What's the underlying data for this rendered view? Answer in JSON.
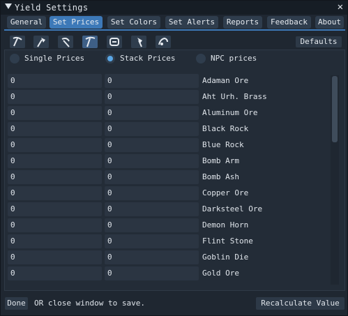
{
  "window": {
    "title": "Yield Settings"
  },
  "tabs": [
    {
      "label": "General"
    },
    {
      "label": "Set Prices"
    },
    {
      "label": "Set Colors"
    },
    {
      "label": "Set Alerts"
    },
    {
      "label": "Reports"
    },
    {
      "label": "Feedback"
    },
    {
      "label": "About"
    }
  ],
  "tools": [
    "pickaxe-icon",
    "hatchet-icon",
    "sickle-icon",
    "pickaxe-alt-icon",
    "fishing-rod-icon",
    "hatchet-alt-icon",
    "clamming-icon"
  ],
  "defaults_label": "Defaults",
  "price_modes": [
    {
      "label": "Single Prices",
      "selected": false
    },
    {
      "label": "Stack Prices",
      "selected": true
    },
    {
      "label": "NPC prices",
      "selected": false
    }
  ],
  "items": [
    {
      "price1": "0",
      "price2": "0",
      "name": "Adaman Ore"
    },
    {
      "price1": "0",
      "price2": "0",
      "name": "Aht Urh. Brass"
    },
    {
      "price1": "0",
      "price2": "0",
      "name": "Aluminum Ore"
    },
    {
      "price1": "0",
      "price2": "0",
      "name": "Black Rock"
    },
    {
      "price1": "0",
      "price2": "0",
      "name": "Blue Rock"
    },
    {
      "price1": "0",
      "price2": "0",
      "name": "Bomb Arm"
    },
    {
      "price1": "0",
      "price2": "0",
      "name": "Bomb Ash"
    },
    {
      "price1": "0",
      "price2": "0",
      "name": "Copper Ore"
    },
    {
      "price1": "0",
      "price2": "0",
      "name": "Darksteel Ore"
    },
    {
      "price1": "0",
      "price2": "0",
      "name": "Demon Horn"
    },
    {
      "price1": "0",
      "price2": "0",
      "name": "Flint Stone"
    },
    {
      "price1": "0",
      "price2": "0",
      "name": "Goblin Die"
    },
    {
      "price1": "0",
      "price2": "0",
      "name": "Gold Ore"
    }
  ],
  "footer": {
    "done_label": "Done",
    "hint": "OR close window to save.",
    "recalc_label": "Recalculate Value"
  },
  "colors": {
    "accent": "#3d79b8",
    "radio_dot": "#5aa7e6"
  }
}
